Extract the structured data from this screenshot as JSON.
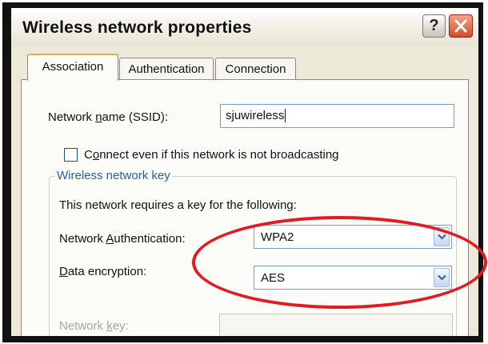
{
  "window": {
    "title": "Wireless network properties",
    "help_glyph": "?"
  },
  "tabs": [
    {
      "label": "Association",
      "active": true
    },
    {
      "label": "Authentication",
      "active": false
    },
    {
      "label": "Connection",
      "active": false
    }
  ],
  "association": {
    "ssid_label": "Network name (SSID):",
    "ssid_value": "sjuwireless",
    "broadcast_checkbox_label": "Connect even if this network is not broadcasting",
    "broadcast_checked": false
  },
  "key_group": {
    "title": "Wireless network key",
    "description": "This network requires a key for the following:",
    "auth_label": "Network Authentication:",
    "auth_value": "WPA2",
    "encryption_label": "Data encryption:",
    "encryption_value": "AES",
    "key_label": "Network key:",
    "key_value": ""
  },
  "highlight_color": "#e11b22",
  "icons": [
    "help-icon",
    "close-icon",
    "dropdown-arrow-icon"
  ]
}
